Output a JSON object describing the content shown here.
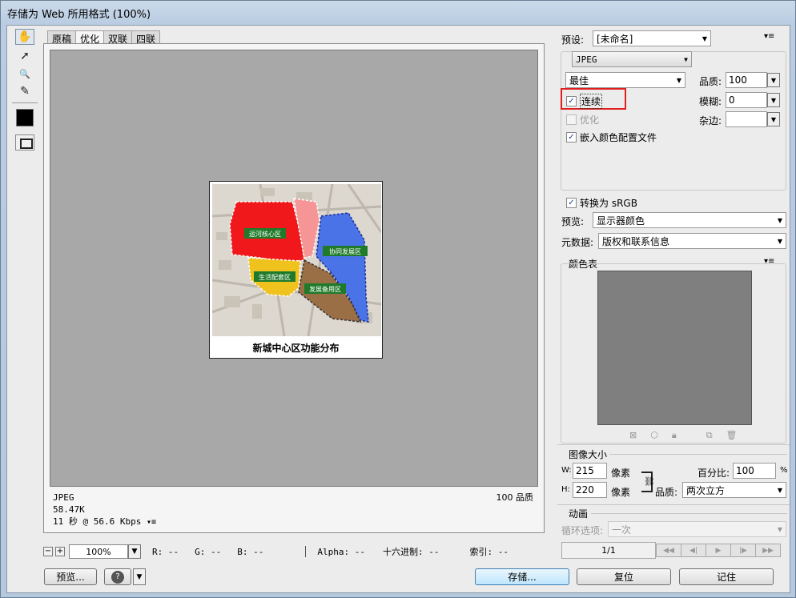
{
  "window": {
    "title": "存储为 Web 所用格式 (100%)"
  },
  "tools": [
    {
      "name": "hand-tool",
      "glyph": "✋"
    },
    {
      "name": "slice-select-tool",
      "glyph": "➚"
    },
    {
      "name": "zoom-tool",
      "glyph": "🔍"
    },
    {
      "name": "eyedropper-tool",
      "glyph": "✎"
    }
  ],
  "tabs": [
    "原稿",
    "优化",
    "双联",
    "四联"
  ],
  "active_tab": "优化",
  "preview_image": {
    "caption": "新城中心区功能分布",
    "labels": [
      "运河核心区",
      "协同发展区",
      "生活配套区",
      "发展备用区"
    ]
  },
  "info": {
    "format": "JPEG",
    "size": "58.47K",
    "download_time": "11 秒 @ 56.6 Kbps",
    "quality": "100 品质"
  },
  "status": {
    "zoom": "100%",
    "r": "R: --",
    "g": "G: --",
    "b": "B: --",
    "alpha": "Alpha: --",
    "hex": "十六进制: --",
    "index": "索引: --"
  },
  "buttons": {
    "preview": "预览...",
    "save": "存储...",
    "reset": "复位",
    "remember": "记住"
  },
  "settings": {
    "preset_label": "预设:",
    "preset_value": "[未命名]",
    "format": "JPEG",
    "quality_preset": "最佳",
    "quality_label": "品质:",
    "quality_value": "100",
    "progressive_label": "连续",
    "progressive_checked": true,
    "blur_label": "模糊:",
    "blur_value": "0",
    "optimized_label": "优化",
    "optimized_checked": false,
    "matte_label": "杂边:",
    "matte_value": "",
    "embed_profile_label": "嵌入颜色配置文件",
    "embed_profile_checked": true,
    "convert_srgb_label": "转换为 sRGB",
    "convert_srgb_checked": true,
    "preview_label": "预览:",
    "preview_value": "显示器颜色",
    "metadata_label": "元数据:",
    "metadata_value": "版权和联系信息"
  },
  "color_table": {
    "title": "颜色表"
  },
  "image_size": {
    "title": "图像大小",
    "w_label": "W:",
    "w_value": "215",
    "h_label": "H:",
    "h_value": "220",
    "unit": "像素",
    "percent_label": "百分比:",
    "percent_value": "100",
    "percent_unit": "%",
    "quality_label": "品质:",
    "quality_value": "两次立方"
  },
  "animation": {
    "title": "动画",
    "loop_label": "循环选项:",
    "loop_value": "一次",
    "frame_counter": "1/1"
  }
}
